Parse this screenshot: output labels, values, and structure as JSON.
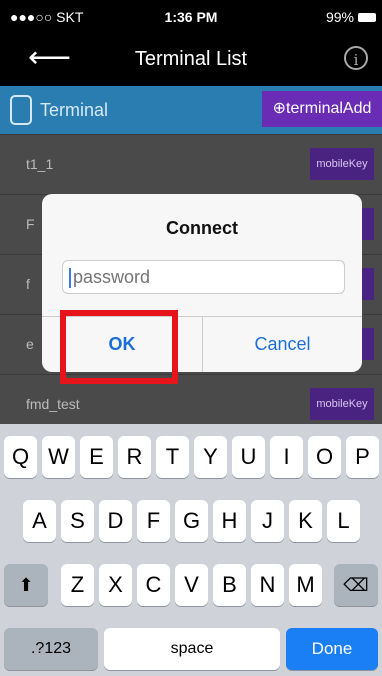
{
  "status_bar": {
    "carrier": "●●●○○ SKT",
    "time": "1:36 PM",
    "battery": "99%"
  },
  "nav": {
    "back_icon": "arrow-left",
    "title": "Terminal List",
    "info_icon": "info"
  },
  "header": {
    "label": "Terminal",
    "add_button": "⊕terminalAdd"
  },
  "rows": [
    {
      "name": "t1_1",
      "key_label": "mobileKey"
    },
    {
      "name": "F",
      "key_label": "ey"
    },
    {
      "name": "f",
      "key_label": "ey"
    },
    {
      "name": "e",
      "key_label": "ey"
    },
    {
      "name": "fmd_test",
      "key_label": "mobileKey"
    }
  ],
  "dialog": {
    "title": "Connect",
    "placeholder": "password",
    "ok": "OK",
    "cancel": "Cancel"
  },
  "keyboard": {
    "row1": [
      "Q",
      "W",
      "E",
      "R",
      "T",
      "Y",
      "U",
      "I",
      "O",
      "P"
    ],
    "row2": [
      "A",
      "S",
      "D",
      "F",
      "G",
      "H",
      "J",
      "K",
      "L"
    ],
    "row3": [
      "Z",
      "X",
      "C",
      "V",
      "B",
      "N",
      "M"
    ],
    "numbers_key": ".?123",
    "space_key": "space",
    "done_key": "Done"
  },
  "colors": {
    "header": "#2a7db0",
    "accent_purple": "#6a2bb5",
    "highlight": "#e8141c",
    "ios_blue": "#1a7ff5"
  }
}
